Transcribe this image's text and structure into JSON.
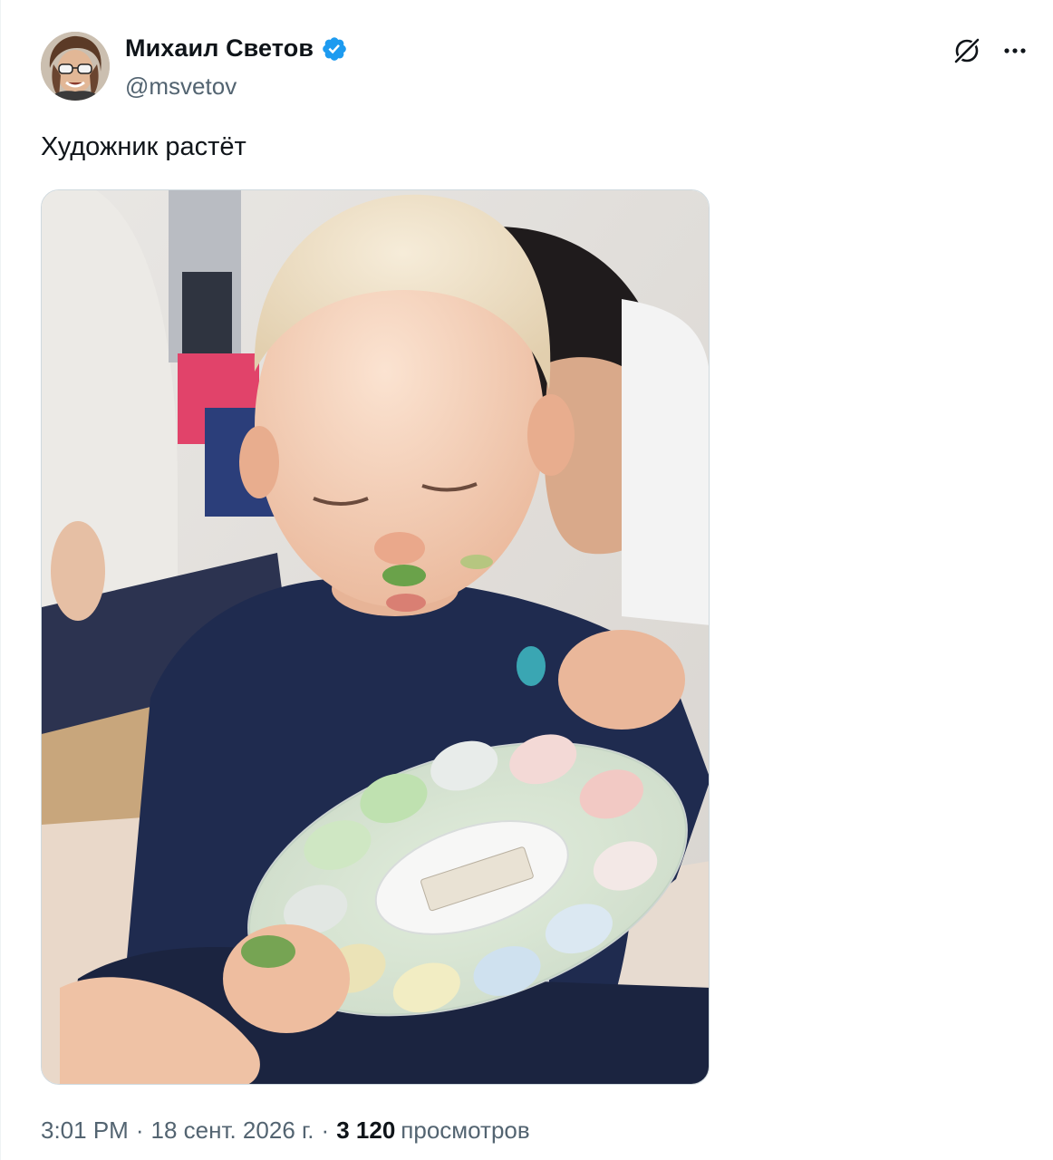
{
  "author": {
    "display_name": "Михаил Светов",
    "handle": "@msvetov",
    "verified": true
  },
  "tweet": {
    "text": "Художник растёт"
  },
  "meta": {
    "time": "3:01 PM",
    "separator": "·",
    "date": "18 сент. 2026 г.",
    "views_count": "3 120",
    "views_label": "просмотров"
  },
  "icons": {
    "verified": "verified-badge-icon",
    "grok": "grok-icon",
    "more": "more-dots-icon"
  },
  "colors": {
    "text_primary": "#0f1419",
    "text_secondary": "#536471",
    "verified_blue": "#1d9bf0",
    "border": "#cfd9de"
  }
}
